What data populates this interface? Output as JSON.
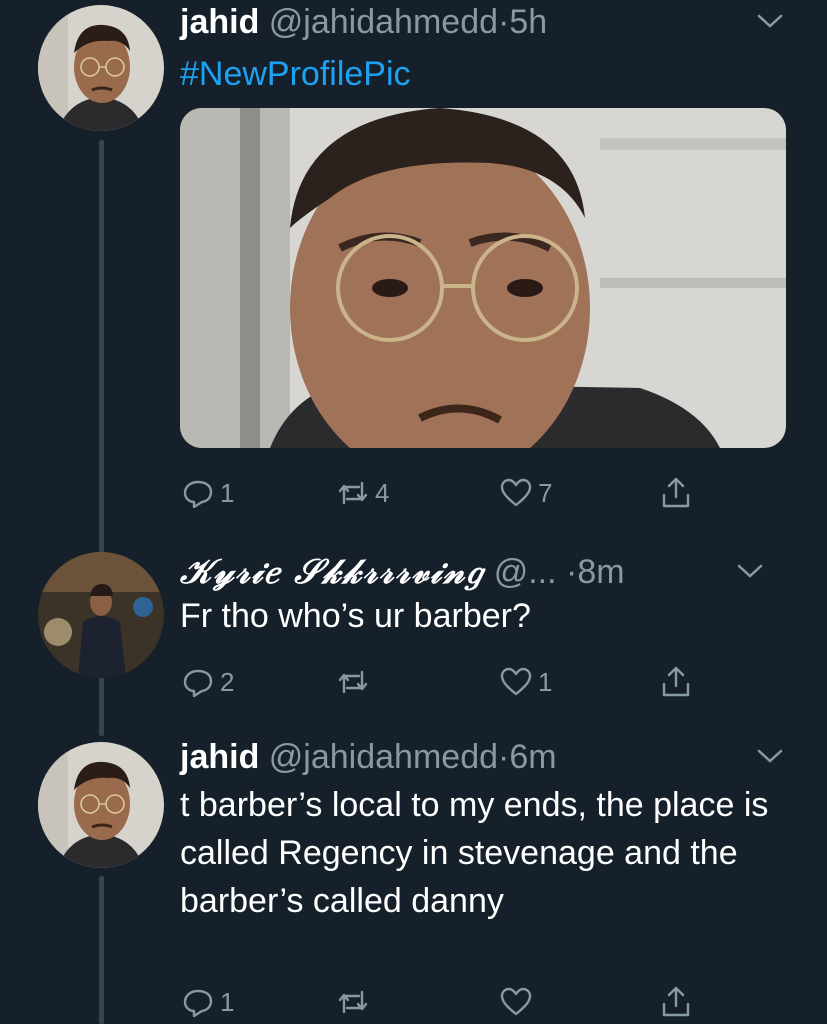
{
  "tweets": [
    {
      "name": "jahid",
      "handle": "@jahidahmedd",
      "dot": "·",
      "time": "5h",
      "hashtag": "#NewProfilePic",
      "actions": {
        "reply": "1",
        "retweet": "4",
        "like": "7"
      }
    },
    {
      "name": "𝒦𝓎𝓇𝒾𝑒 𝒮𝓀𝓀𝓇𝓇𝓇𝓋𝒾𝓃𝑔",
      "handle": "@...",
      "dot": "·",
      "time": "8m",
      "text": "Fr tho who’s ur barber?",
      "actions": {
        "reply": "2",
        "retweet": "",
        "like": "1"
      }
    },
    {
      "name": "jahid",
      "handle": "@jahidahmedd",
      "dot": "·",
      "time": "6m",
      "text": "t barber’s local to my ends, the place is called Regency in stevenage and the barber’s called danny",
      "actions": {
        "reply": "1",
        "retweet": "",
        "like": ""
      }
    }
  ],
  "colors": {
    "background": "#15202b",
    "secondary": "#8899a6",
    "accent": "#1da1f2",
    "thread_line": "#38444d"
  }
}
